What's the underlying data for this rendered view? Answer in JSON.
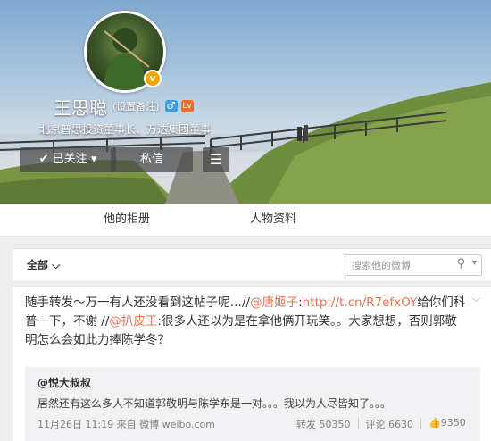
{
  "profile": {
    "name": "王思聪",
    "remark": "(设置备注)",
    "gender_icon": "♂",
    "level_icon": "Lv",
    "verified_icon": "v",
    "intro": "北京普思投资董事长、万达集团董事"
  },
  "actions": {
    "follow_label": "✔ 已关注 ▾",
    "message_label": "私信",
    "more_label": "☰"
  },
  "tabs": [
    "他的相册",
    "人物资料"
  ],
  "filter": {
    "all_label": "全部 ⌵",
    "search_placeholder": "搜索他的微博",
    "search_icon": "⚲"
  },
  "post": {
    "text_parts": [
      "随手转发～万一有人还没看到这帖子呢…//",
      "@唐姬子",
      ":",
      "http://t.cn/R7efxOY",
      "给你们科普一下，不谢 //",
      "@扒皮王",
      ":很多人还以为是在拿他俩开玩笑。。大家想想，否则郭敬明怎么会如此力捧陈学冬？"
    ],
    "more_icon": "⌵",
    "quote": {
      "author": "@悦大叔叔",
      "text": "居然还有这么多人不知道郭敬明与陈学东是一对。。。我以为人尽皆知了。。。",
      "meta": "11月26日 11:19 来自 微博 weibo.com",
      "repost": "转发 50350",
      "comment": "评论 6630",
      "like": "👍9350"
    }
  }
}
